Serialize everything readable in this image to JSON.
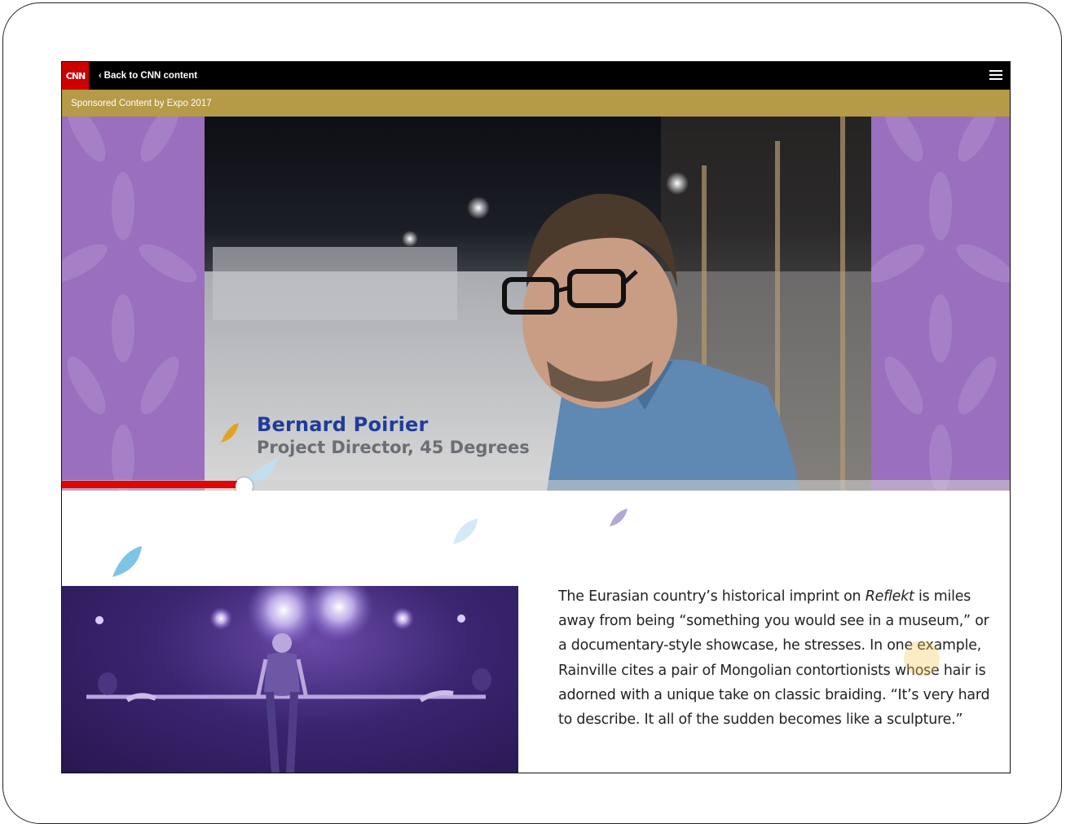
{
  "topbar": {
    "logo_text": "CNN",
    "back_label": "Back to CNN content",
    "back_chevron": "‹",
    "menu_icon": "hamburger-menu-icon"
  },
  "sponsor": {
    "text": "Sponsored Content by Expo 2017",
    "color": "#b59a47"
  },
  "video": {
    "caption_name": "Bernard Poirier",
    "caption_role": "Project Director, 45 Degrees",
    "progress_fraction": 0.193,
    "progress_color": "#e10600",
    "pattern_color": "#9a6fbd"
  },
  "article": {
    "before_italic": "The Eurasian country’s historical imprint on ",
    "italic": "Reflekt",
    "after_italic": " is miles away from being “something you would see in a museum,” or a documentary-style showcase, he stresses. In one example, Rainville cites a pair of Mongolian contortionists whose hair is adorned with a unique take on classic braiding. “It’s very hard to describe. It all of the sudden becomes like a sculpture.”"
  }
}
